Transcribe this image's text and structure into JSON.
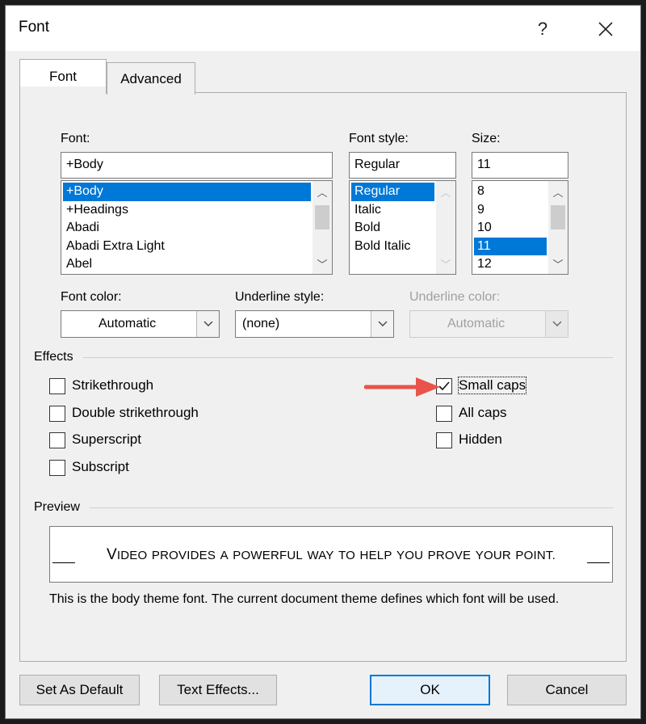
{
  "window": {
    "title": "Font",
    "help_label": "?",
    "close_label": "✕"
  },
  "tabs": [
    {
      "label": "Font",
      "active": true
    },
    {
      "label": "Advanced",
      "active": false
    }
  ],
  "font": {
    "label": "Font:",
    "value": "+Body",
    "items": [
      "+Body",
      "+Headings",
      "Abadi",
      "Abadi Extra Light",
      "Abel"
    ],
    "selected": "+Body"
  },
  "font_style": {
    "label": "Font style:",
    "value": "Regular",
    "items": [
      "Regular",
      "Italic",
      "Bold",
      "Bold Italic"
    ],
    "selected": "Regular"
  },
  "size": {
    "label": "Size:",
    "value": "11",
    "items": [
      "8",
      "9",
      "10",
      "11",
      "12"
    ],
    "selected": "11"
  },
  "font_color": {
    "label": "Font color:",
    "value": "Automatic"
  },
  "underline_style": {
    "label": "Underline style:",
    "value": "(none)"
  },
  "underline_color": {
    "label": "Underline color:",
    "value": "Automatic",
    "disabled": true
  },
  "effects": {
    "label": "Effects",
    "left": [
      {
        "label": "Strikethrough",
        "checked": false
      },
      {
        "label": "Double strikethrough",
        "checked": false
      },
      {
        "label": "Superscript",
        "checked": false
      },
      {
        "label": "Subscript",
        "checked": false
      }
    ],
    "right": [
      {
        "label": "Small caps",
        "checked": true
      },
      {
        "label": "All caps",
        "checked": false
      },
      {
        "label": "Hidden",
        "checked": false
      }
    ]
  },
  "preview": {
    "label": "Preview",
    "text": "Video provides a powerful way to help you prove your point.",
    "description": "This is the body theme font. The current document theme defines which font will be used."
  },
  "buttons": {
    "set_default": "Set As Default",
    "text_effects": "Text Effects...",
    "ok": "OK",
    "cancel": "Cancel"
  },
  "colors": {
    "selection": "#0078d7",
    "arrow": "#e8534a",
    "dialog_bg": "#f0f0f0"
  },
  "icons": {
    "help": "question-mark-icon",
    "close": "close-x-icon",
    "dropdown": "chevron-down-icon",
    "scroll_up": "chevron-up-icon",
    "scroll_down": "chevron-down-icon",
    "check": "checkmark-icon",
    "annotation_arrow": "red-arrow-icon"
  }
}
